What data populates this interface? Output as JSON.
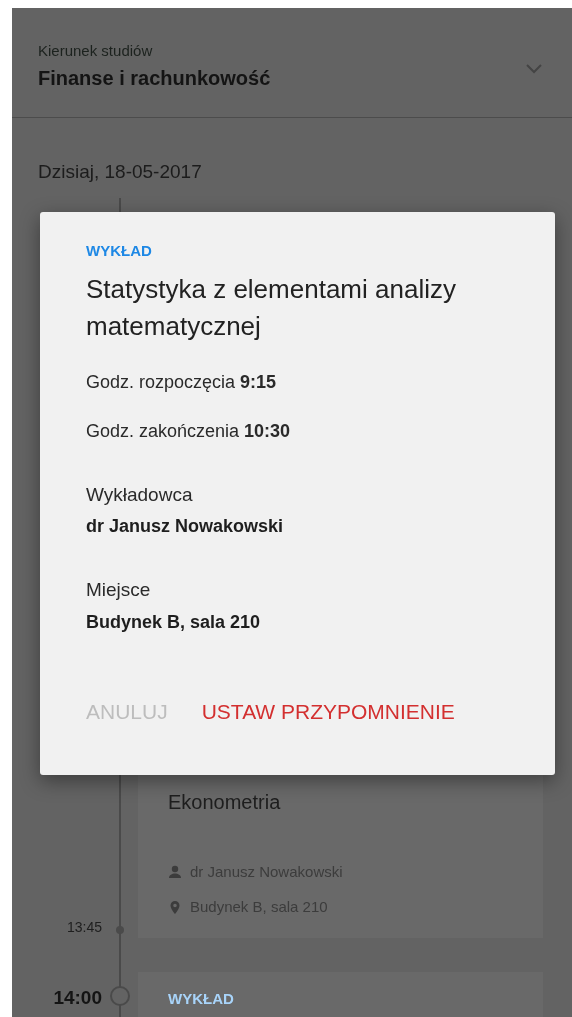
{
  "header": {
    "label": "Kierunek studiów",
    "value": "Finanse i rachunkowość"
  },
  "date": "Dzisiaj, 18-05-2017",
  "schedule": [
    {
      "title": "Ekonometria",
      "lecturer": "dr Janusz Nowakowski",
      "place": "Budynek B, sala 210",
      "end_time": "13:45"
    },
    {
      "start_time": "14:00",
      "type": "WYKŁAD"
    }
  ],
  "dialog": {
    "type": "WYKŁAD",
    "title": "Statystyka z elementami analizy matematycznej",
    "lines": [
      "Godz. rozpoczęcia **9:15**",
      "Godz. zakończenia **10:30**"
    ],
    "details": [
      {
        "label": "Wykładowca",
        "value": "dr Janusz Nowakowski"
      },
      {
        "label": "Miejsce",
        "value": "Budynek B, sala 210"
      }
    ],
    "buttons": [
      {
        "label": "ANULUJ",
        "kind": "cancel"
      },
      {
        "label": "USTAW PRZYPOMNIENIE",
        "kind": "confirm"
      }
    ]
  }
}
